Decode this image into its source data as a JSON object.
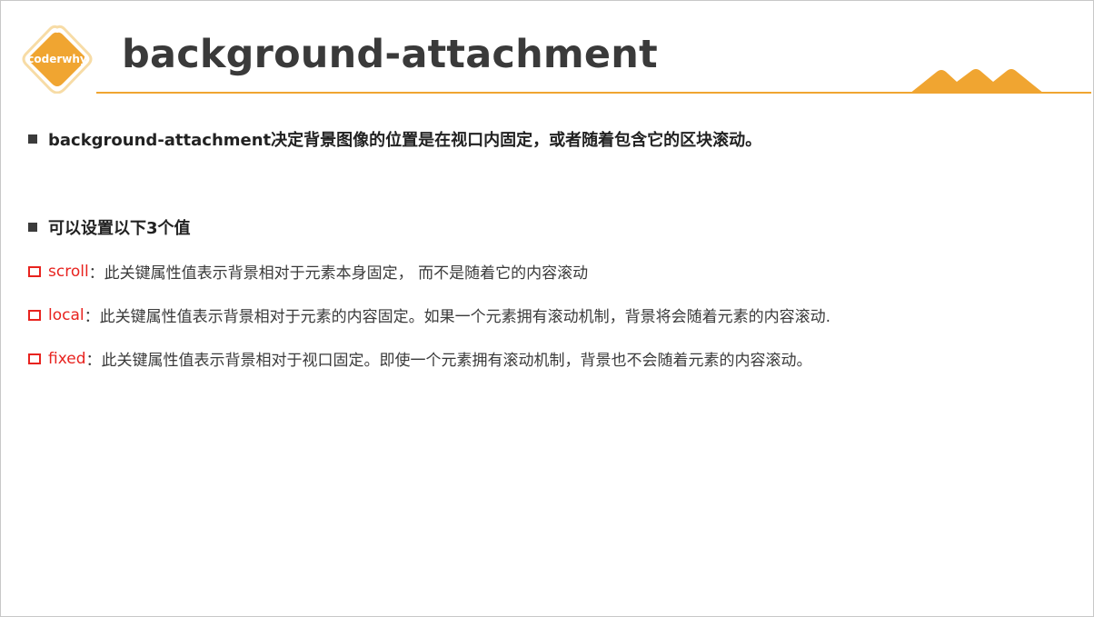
{
  "header": {
    "logo_text": "coderwhy",
    "title": "background-attachment",
    "accent_color": "#f0a531"
  },
  "content": {
    "intro": "background-attachment决定背景图像的位置是在视口内固定，或者随着包含它的区块滚动。",
    "values_heading": "可以设置以下3个值",
    "items": [
      {
        "keyword": "scroll",
        "description": "：此关键属性值表示背景相对于元素本身固定， 而不是随着它的内容滚动"
      },
      {
        "keyword": "local",
        "description": "：此关键属性值表示背景相对于元素的内容固定。如果一个元素拥有滚动机制，背景将会随着元素的内容滚动."
      },
      {
        "keyword": "fixed",
        "description": "：此关键属性值表示背景相对于视口固定。即使一个元素拥有滚动机制，背景也不会随着元素的内容滚动。"
      }
    ],
    "keyword_color": "#e8231f"
  }
}
